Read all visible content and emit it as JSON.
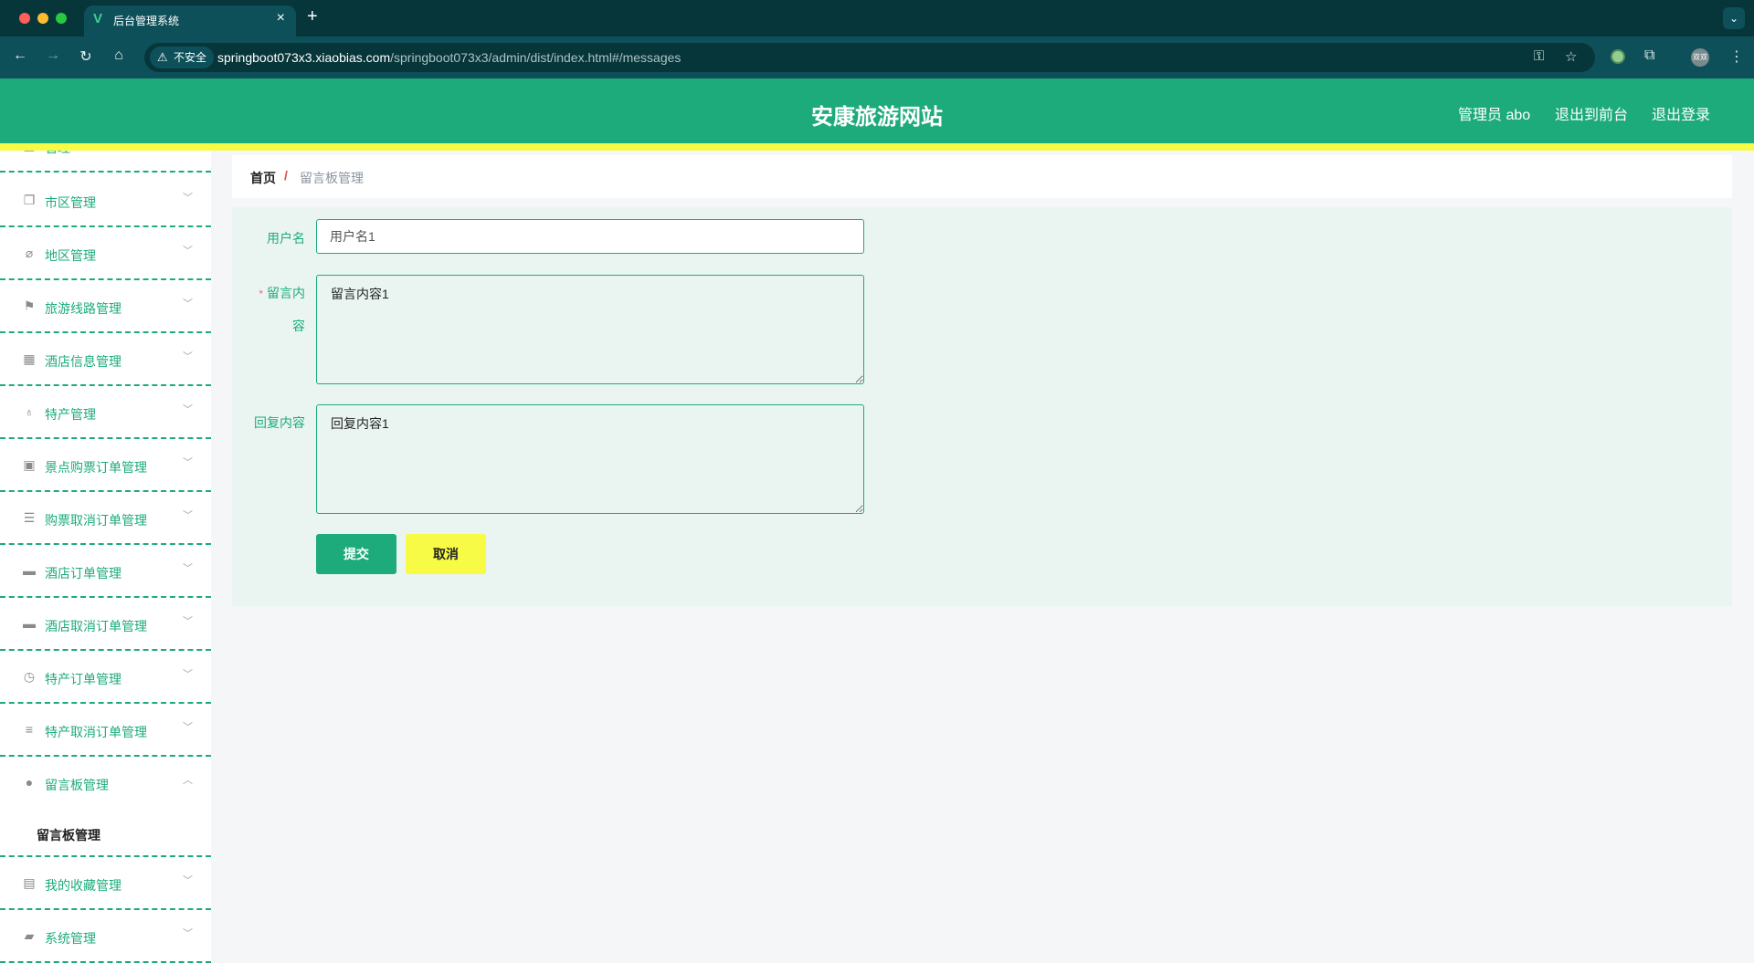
{
  "browser": {
    "tab_title": "后台管理系统",
    "tab_favicon": "V",
    "insecure_label": "不安全",
    "url_host": "springboot073x3.xiaobias.com",
    "url_path": "/springboot073x3/admin/dist/index.html#/messages",
    "avatar_text": "双双"
  },
  "header": {
    "title": "安康旅游网站",
    "user_label": "管理员 abo",
    "to_front": "退出到前台",
    "logout": "退出登录"
  },
  "sidebar": {
    "partial_item": "管理",
    "items": [
      {
        "label": "市区管理",
        "icon": "copy-icon"
      },
      {
        "label": "地区管理",
        "icon": "bell-off-icon"
      },
      {
        "label": "旅游线路管理",
        "icon": "flag-icon"
      },
      {
        "label": "酒店信息管理",
        "icon": "grid-icon"
      },
      {
        "label": "特产管理",
        "icon": "microphone-icon"
      },
      {
        "label": "景点购票订单管理",
        "icon": "clipboard-icon"
      },
      {
        "label": "购票取消订单管理",
        "icon": "list-icon"
      },
      {
        "label": "酒店订单管理",
        "icon": "monitor-icon"
      },
      {
        "label": "酒店取消订单管理",
        "icon": "printer-icon"
      },
      {
        "label": "特产订单管理",
        "icon": "clock-icon"
      },
      {
        "label": "特产取消订单管理",
        "icon": "sliders-icon"
      },
      {
        "label": "留言板管理",
        "icon": "balloon-icon"
      },
      {
        "label": "我的收藏管理",
        "icon": "notebook-icon"
      },
      {
        "label": "系统管理",
        "icon": "ticket-icon"
      }
    ],
    "submenu": {
      "label": "留言板管理"
    }
  },
  "breadcrumb": {
    "home": "首页",
    "separator": "/",
    "current": "留言板管理"
  },
  "form": {
    "username_label": "用户名",
    "username_value": "用户名1",
    "content_label_1": "留言内",
    "content_label_2": "容",
    "content_required": "*",
    "content_value": "留言内容1",
    "reply_label": "回复内容",
    "reply_value": "回复内容1",
    "submit_label": "提交",
    "cancel_label": "取消"
  },
  "colors": {
    "primary": "#1dab7c",
    "accent_yellow": "#f7fb45",
    "panel_bg": "#eaf5f1"
  }
}
